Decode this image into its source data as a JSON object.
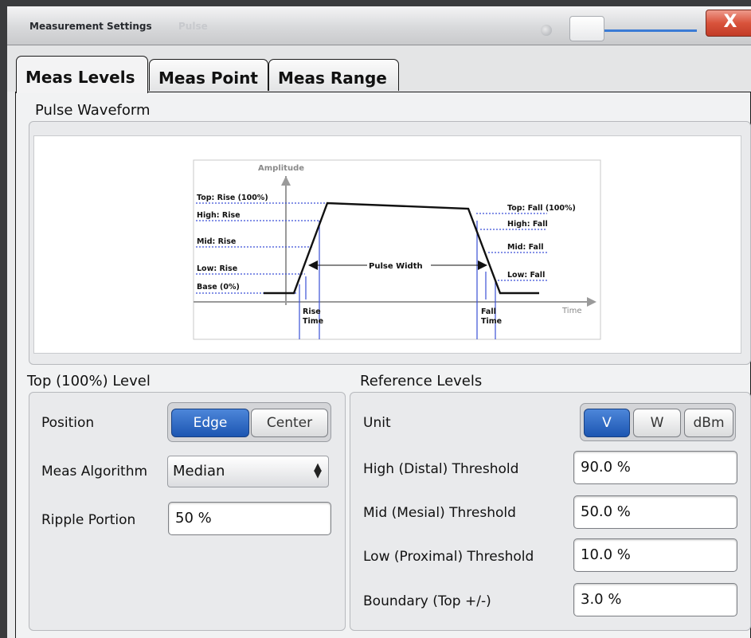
{
  "window": {
    "title": "Measurement Settings",
    "ghost_title": "Pulse",
    "close_label": "X"
  },
  "tabs": [
    {
      "label": "Meas Levels",
      "active": true
    },
    {
      "label": "Meas Point",
      "active": false
    },
    {
      "label": "Meas Range",
      "active": false
    }
  ],
  "pulse_waveform": {
    "title": "Pulse Waveform",
    "diagram": {
      "y_axis_label": "Amplitude",
      "x_axis_label": "Time",
      "left_labels": [
        "Top: Rise (100%)",
        "High: Rise",
        "Mid: Rise",
        "Low: Rise",
        "Base (0%)"
      ],
      "right_labels": [
        "Top: Fall (100%)",
        "High: Fall",
        "Mid: Fall",
        "Low: Fall"
      ],
      "pulse_width_label": "Pulse Width",
      "rise_time_label": [
        "Rise",
        "Time"
      ],
      "fall_time_label": [
        "Fall",
        "Time"
      ]
    }
  },
  "top_level": {
    "title": "Top (100%) Level",
    "position_label": "Position",
    "position_options": [
      "Edge",
      "Center"
    ],
    "position_selected": "Edge",
    "algorithm_label": "Meas Algorithm",
    "algorithm_value": "Median",
    "ripple_label": "Ripple Portion",
    "ripple_value": "50 %"
  },
  "reference_levels": {
    "title": "Reference Levels",
    "unit_label": "Unit",
    "unit_options": [
      "V",
      "W",
      "dBm"
    ],
    "unit_selected": "V",
    "high_label": "High (Distal) Threshold",
    "high_value": "90.0 %",
    "mid_label": "Mid (Mesial) Threshold",
    "mid_value": "50.0 %",
    "low_label": "Low (Proximal) Threshold",
    "low_value": "10.0 %",
    "boundary_label": "Boundary (Top +/-)",
    "boundary_value": "3.0 %"
  },
  "colors": {
    "accent": "#1c56b2",
    "close": "#c9442e",
    "level_lines": "#3a4fd6"
  }
}
